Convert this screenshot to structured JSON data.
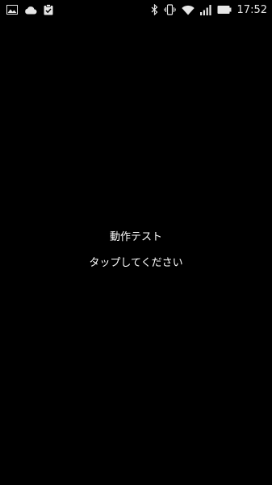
{
  "status_bar": {
    "time": "17:52",
    "left_icons": [
      "image-icon",
      "cloud-icon",
      "clipboard-check-icon"
    ],
    "right_icons": [
      "bluetooth-icon",
      "vibrate-icon",
      "wifi-icon",
      "signal-icon",
      "battery-icon"
    ]
  },
  "main": {
    "title": "動作テスト",
    "instruction": "タップしてください"
  },
  "colors": {
    "background": "#000000",
    "text": "#ffffff",
    "status_icons": "#e6e6e6"
  }
}
